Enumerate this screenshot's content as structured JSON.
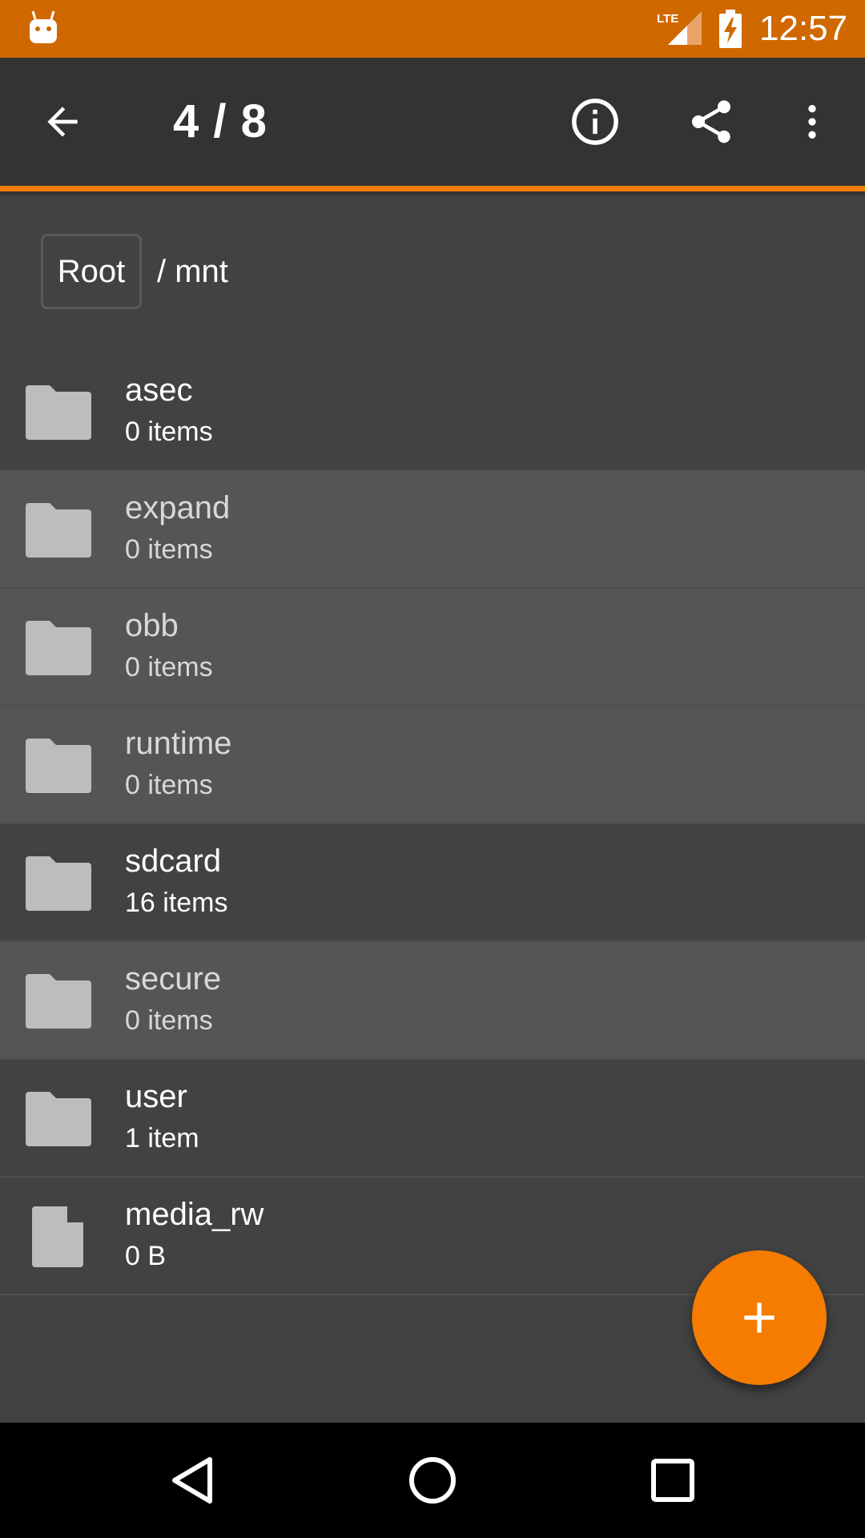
{
  "status_bar": {
    "time": "12:57",
    "network": "LTE",
    "icons": [
      "android-debug-icon",
      "lte-signal-icon",
      "battery-charging-icon"
    ]
  },
  "toolbar": {
    "title": "4 / 8",
    "icons": [
      "back-arrow-icon",
      "info-icon",
      "share-icon",
      "more-vert-icon"
    ]
  },
  "breadcrumb": {
    "root_label": "Root",
    "path": "/ mnt"
  },
  "files": [
    {
      "name": "asec",
      "meta": "0 items",
      "type": "folder",
      "dimmed": false
    },
    {
      "name": "expand",
      "meta": "0 items",
      "type": "folder",
      "dimmed": true
    },
    {
      "name": "obb",
      "meta": "0 items",
      "type": "folder",
      "dimmed": true
    },
    {
      "name": "runtime",
      "meta": "0 items",
      "type": "folder",
      "dimmed": true
    },
    {
      "name": "sdcard",
      "meta": "16 items",
      "type": "folder",
      "dimmed": false
    },
    {
      "name": "secure",
      "meta": "0 items",
      "type": "folder",
      "dimmed": true
    },
    {
      "name": "user",
      "meta": "1 item",
      "type": "folder",
      "dimmed": false
    },
    {
      "name": "media_rw",
      "meta": "0 B",
      "type": "file",
      "dimmed": false
    }
  ],
  "fab": {
    "icon": "plus-icon"
  },
  "nav_bar": {
    "icons": [
      "nav-back-icon",
      "nav-home-icon",
      "nav-recents-icon"
    ]
  },
  "colors": {
    "status_bar": "#d06800",
    "accent": "#f57c00",
    "toolbar": "#333333",
    "background": "#424242",
    "dimmed_row": "#555555"
  }
}
